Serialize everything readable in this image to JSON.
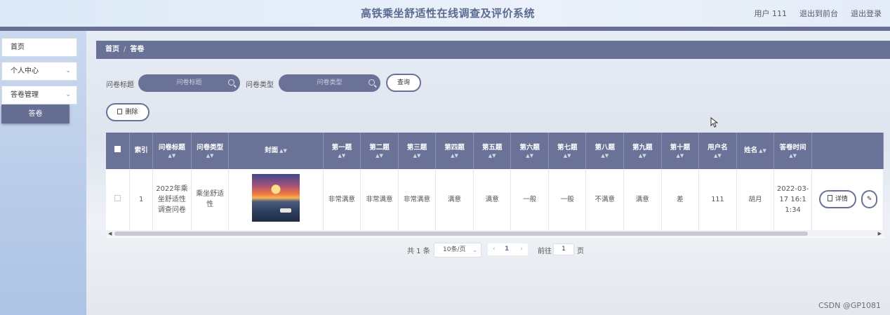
{
  "header": {
    "title": "高铁乘坐舒适性在线调查及评价系统",
    "user": "用户 111",
    "back_link": "退出到前台",
    "logout": "退出登录"
  },
  "sidebar": {
    "items": [
      {
        "label": "首页"
      },
      {
        "label": "个人中心"
      },
      {
        "label": "答卷管理"
      }
    ],
    "sub_item": "答卷"
  },
  "breadcrumb": {
    "home": "首页",
    "separator": "/",
    "current": "答卷"
  },
  "search": {
    "title_label": "问卷标题",
    "title_placeholder": "问卷标题",
    "type_label": "问卷类型",
    "type_placeholder": "问卷类型",
    "query_button": "查询"
  },
  "actions": {
    "delete_button": "删除"
  },
  "table": {
    "headers": [
      "索引",
      "问卷标题",
      "问卷类型",
      "封面",
      "第一题",
      "第二题",
      "第三题",
      "第四题",
      "第五题",
      "第六题",
      "第七题",
      "第八题",
      "第九题",
      "第十题",
      "用户名",
      "姓名",
      "答卷时间"
    ],
    "rows": [
      {
        "index": "1",
        "title": "2022年乘坐舒适性调查问卷",
        "type": "乘坐舒适性",
        "q1": "非常满意",
        "q2": "非常满意",
        "q3": "非常满意",
        "q4": "满意",
        "q5": "满意",
        "q6": "一般",
        "q7": "一般",
        "q8": "不满意",
        "q9": "满意",
        "q10": "差",
        "username": "111",
        "name": "胡月",
        "time": "2022-03-17 16:11:34",
        "detail_button": "详情"
      }
    ]
  },
  "pagination": {
    "total": "共 1 条",
    "page_size": "10条/页",
    "current_page": "1",
    "goto_label": "前往",
    "goto_value": "1",
    "page_unit": "页"
  },
  "watermark": "CSDN @GP1081",
  "colors": {
    "accent": "#6b7298",
    "header_bar": "#676f96",
    "sidebar": "#b8cbe8"
  }
}
